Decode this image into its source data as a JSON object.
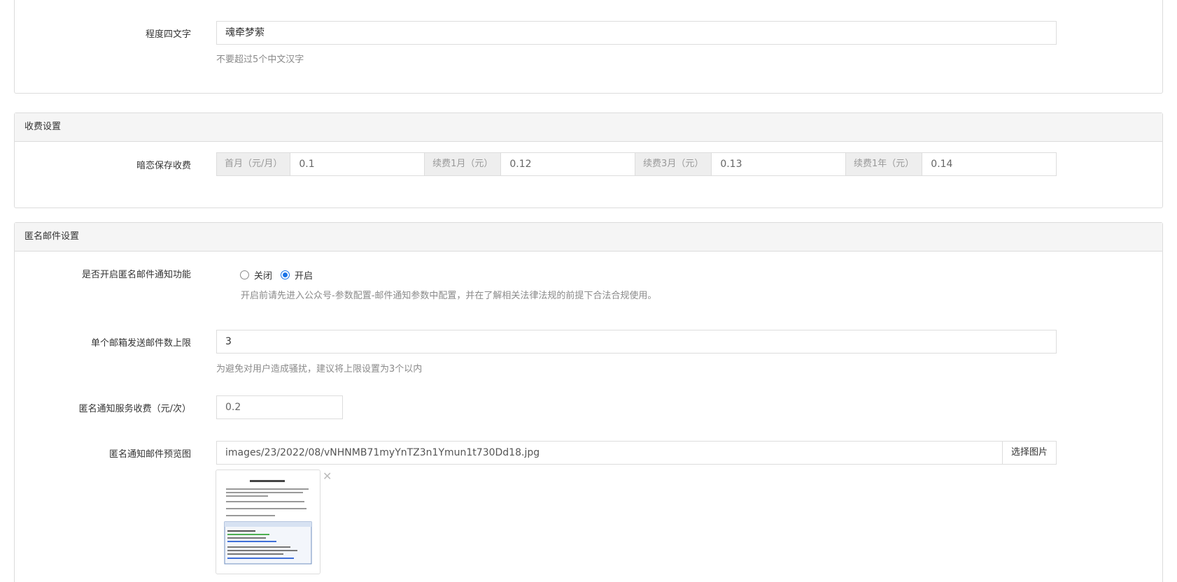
{
  "section1": {
    "field_label": "程度四文字",
    "field_value": "魂牵梦萦",
    "help": "不要超过5个中文汉字"
  },
  "fees": {
    "heading": "收费设置",
    "label": "暗恋保存收费",
    "items": [
      {
        "addon": "首月（元/月）",
        "value": "0.1"
      },
      {
        "addon": "续费1月（元）",
        "value": "0.12"
      },
      {
        "addon": "续费3月（元）",
        "value": "0.13"
      },
      {
        "addon": "续费1年（元）",
        "value": "0.14"
      }
    ]
  },
  "mail": {
    "heading": "匿名邮件设置",
    "enable_label": "是否开启匿名邮件通知功能",
    "option_off": "关闭",
    "option_on": "开启",
    "selected": "开启",
    "enable_help": "开启前请先进入公众号-参数配置-邮件通知参数中配置，并在了解相关法律法规的前提下合法合规使用。",
    "limit_label": "单个邮箱发送邮件数上限",
    "limit_value": "3",
    "limit_help": "为避免对用户造成骚扰，建议将上限设置为3个以内",
    "fee_label": "匿名通知服务收费（元/次）",
    "fee_value": "0.2",
    "preview_label": "匿名通知邮件预览图",
    "preview_path": "images/23/2022/08/vNHNMB71myYnTZ3n1Ymun1t730Dd18.jpg",
    "preview_button": "选择图片",
    "remove_icon": "close-icon",
    "accent": "#1a73e8"
  }
}
